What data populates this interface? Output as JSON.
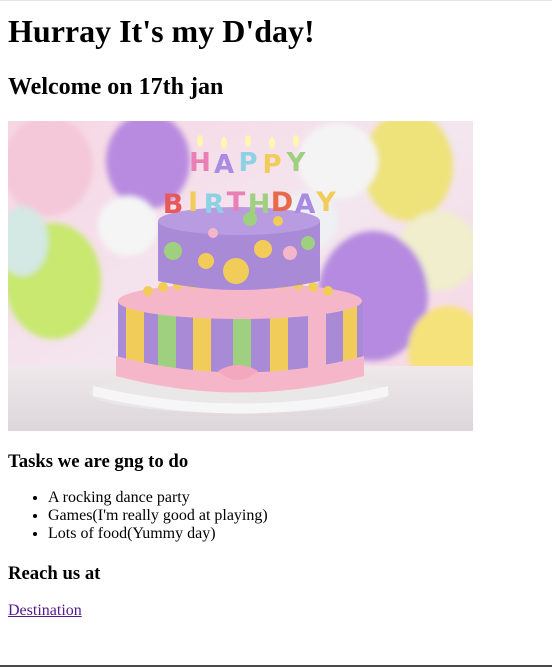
{
  "page": {
    "title": "Hurray It's my D'day!",
    "subtitle": "Welcome on 17th jan",
    "image": {
      "candle_letters_top": [
        "H",
        "A",
        "P",
        "P",
        "Y"
      ],
      "candle_letters_bottom": [
        "B",
        "I",
        "R",
        "T",
        "H",
        "D",
        "A",
        "Y"
      ],
      "colors": {
        "bg_pink": "#f2c9d8",
        "balloon_purple": "#b98be0",
        "balloon_yellow": "#eee27a",
        "balloon_green": "#c8e86f",
        "cake_purple": "#a88ad6",
        "dot_yellow": "#f2cc58",
        "dot_green": "#9fd07f",
        "ribbon_pink": "#f5b6c9",
        "plate": "#f4f4f4"
      }
    },
    "tasks_heading": "Tasks we are gng to do",
    "tasks": [
      "A rocking dance party",
      "Games(I'm really good at playing)",
      "Lots of food(Yummy day)"
    ],
    "contact_heading": "Reach us at",
    "contact_link": "Destination"
  }
}
